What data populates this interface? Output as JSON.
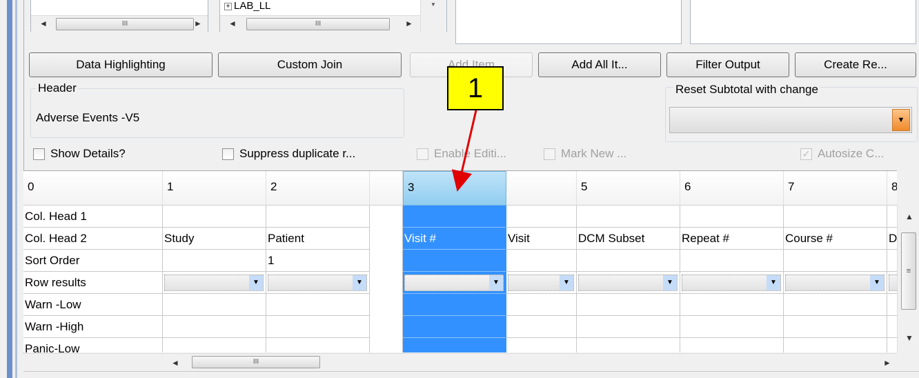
{
  "top_lists": {
    "middle_item_label": "LAB_LL",
    "expand_glyph": "+"
  },
  "buttons": {
    "data_highlighting": "Data Highlighting",
    "custom_join": "Custom Join",
    "add_item": "Add Item",
    "add_all_items": "Add All It...",
    "filter_output": "Filter Output",
    "create_report": "Create Re..."
  },
  "header_box": {
    "title": "Header",
    "value": "Adverse Events -V5"
  },
  "reset_subtotal": {
    "title": "Reset Subtotal with change",
    "value": ""
  },
  "options": {
    "show_details": "Show Details?",
    "suppress_duplicate": "Suppress duplicate r...",
    "enable_editing": "Enable Editi...",
    "mark_new": "Mark New ...",
    "autosize": "Autosize C..."
  },
  "grid": {
    "column_headers": [
      "0",
      "1",
      "2",
      "",
      "3",
      "",
      "5",
      "6",
      "7",
      "8"
    ],
    "selected_column_header": "3",
    "rows": [
      {
        "label": "Col. Head 1",
        "values": [
          "",
          "",
          "",
          "",
          "",
          "",
          "",
          ""
        ]
      },
      {
        "label": "Col. Head 2",
        "values": [
          "Study",
          "Patient",
          "Visit #",
          "Visit",
          "DCM Subset",
          "Repeat #",
          "Course #",
          "D"
        ]
      },
      {
        "label": "Sort Order",
        "values": [
          "",
          "1",
          "",
          "",
          "",
          "",
          "",
          ""
        ]
      },
      {
        "label": "Row results",
        "values": [
          "",
          "",
          "",
          "",
          "",
          "",
          "",
          ""
        ]
      },
      {
        "label": "Warn -Low",
        "values": [
          "",
          "",
          "",
          "",
          "",
          "",
          "",
          ""
        ]
      },
      {
        "label": "Warn -High",
        "values": [
          "",
          "",
          "",
          "",
          "",
          "",
          "",
          ""
        ]
      },
      {
        "label": "Panic-Low",
        "values": [
          "",
          "",
          "",
          "",
          "",
          "",
          "",
          ""
        ]
      }
    ]
  },
  "annotation": {
    "callout_number": "1",
    "callout_color": "#ffff00",
    "arrow_color": "#e00000"
  },
  "colors": {
    "selection": "#3391ff",
    "selected_header": "#90cdf0",
    "dropdown_button": "#c5dcf8",
    "reset_dropdown_button": "#f7a64c"
  },
  "icons": {
    "scroll_left": "◄",
    "scroll_right": "►",
    "scroll_up": "▲",
    "scroll_down": "▼",
    "dropdown": "▼",
    "checkmark": "✓",
    "grip": "III"
  }
}
